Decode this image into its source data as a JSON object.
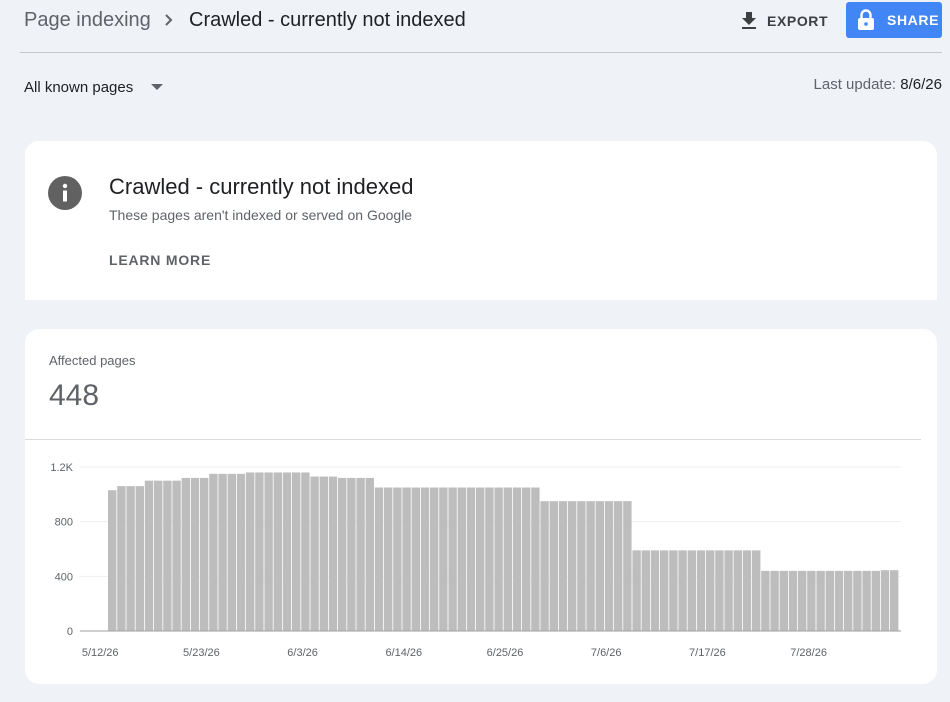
{
  "header": {
    "breadcrumb_root": "Page indexing",
    "breadcrumb_current": "Crawled - currently not indexed",
    "export_label": "EXPORT",
    "share_label": "SHARE",
    "icons": {
      "separator": "chevron-right-icon",
      "export": "download-icon",
      "share": "lock-icon"
    }
  },
  "filter": {
    "selected": "All known pages",
    "icon": "caret-down-icon"
  },
  "last_update": {
    "label": "Last update:",
    "value": "8/6/26"
  },
  "info_card": {
    "icon": "info-icon",
    "title": "Crawled - currently not indexed",
    "subtitle": "These pages aren't indexed or served on Google",
    "learn_more": "LEARN MORE"
  },
  "metric": {
    "label": "Affected pages",
    "value": "448"
  },
  "colors": {
    "accent": "#4285f4",
    "bar": "#bdbdbd",
    "background": "#eff3f8"
  },
  "chart_data": {
    "type": "bar",
    "series": [
      {
        "values": [
          1030,
          1060,
          1060,
          1060,
          1100,
          1100,
          1100,
          1100,
          1120,
          1120,
          1120,
          1150,
          1150,
          1150,
          1150,
          1160,
          1160,
          1160,
          1160,
          1160,
          1160,
          1160,
          1130,
          1130,
          1130,
          1120,
          1120,
          1120,
          1120,
          1050,
          1050,
          1050,
          1050,
          1050,
          1050,
          1050,
          1050,
          1050,
          1050,
          1050,
          1050,
          1050,
          1050,
          1050,
          1050,
          1050,
          1050,
          950,
          950,
          950,
          950,
          950,
          950,
          950,
          950,
          950,
          950,
          590,
          590,
          590,
          590,
          590,
          590,
          590,
          590,
          590,
          590,
          590,
          590,
          590,
          590,
          440,
          440,
          440,
          440,
          440,
          440,
          440,
          440,
          440,
          440,
          440,
          440,
          440,
          445,
          445
        ]
      }
    ],
    "x_start": "5/12/26",
    "x_tick_labels": [
      "5/12/26",
      "5/23/26",
      "6/3/26",
      "6/14/26",
      "6/25/26",
      "7/6/26",
      "7/17/26",
      "7/28/26"
    ],
    "y_tick_labels": [
      "0",
      "400",
      "800",
      "1.2K"
    ],
    "y_ticks": [
      0,
      400,
      800,
      1200
    ],
    "ylim": [
      0,
      1200
    ],
    "grid": true,
    "legend": "none"
  }
}
